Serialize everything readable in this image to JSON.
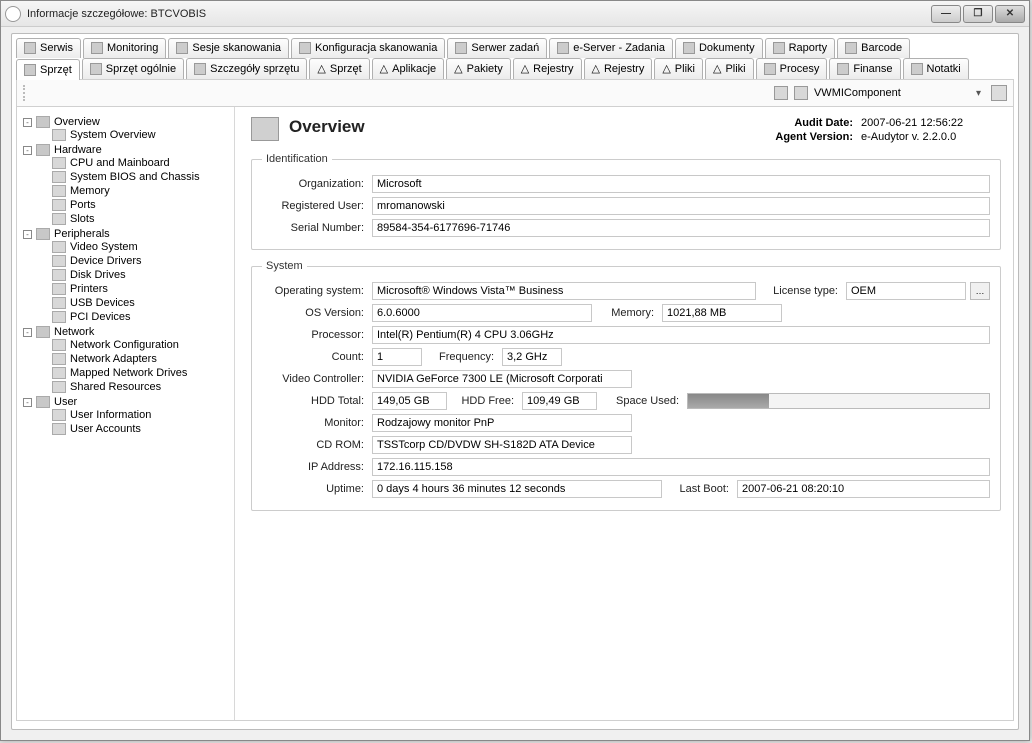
{
  "window": {
    "title": "Informacje szczegółowe: BTCVOBIS"
  },
  "winbuttons": {
    "min": "—",
    "max": "❐",
    "close": "✕"
  },
  "tabs_top": [
    {
      "label": "Serwis"
    },
    {
      "label": "Monitoring"
    },
    {
      "label": "Sesje skanowania"
    },
    {
      "label": "Konfiguracja skanowania"
    },
    {
      "label": "Serwer zadań"
    },
    {
      "label": "e-Server - Zadania"
    },
    {
      "label": "Dokumenty"
    },
    {
      "label": "Raporty"
    },
    {
      "label": "Barcode"
    }
  ],
  "tabs_bottom": [
    {
      "label": "Sprzęt",
      "active": true
    },
    {
      "label": "Sprzęt ogólnie"
    },
    {
      "label": "Szczegóły sprzętu"
    },
    {
      "label": "Sprzęt",
      "tri": true
    },
    {
      "label": "Aplikacje",
      "tri": true
    },
    {
      "label": "Pakiety",
      "tri": true
    },
    {
      "label": "Rejestry",
      "tri": true
    },
    {
      "label": "Rejestry",
      "tri": true
    },
    {
      "label": "Pliki",
      "tri": true
    },
    {
      "label": "Pliki",
      "tri": true
    },
    {
      "label": "Procesy"
    },
    {
      "label": "Finanse"
    },
    {
      "label": "Notatki"
    }
  ],
  "toolbar": {
    "component": "VWMIComponent"
  },
  "tree": {
    "overview": "Overview",
    "system_overview": "System Overview",
    "hardware": "Hardware",
    "cpu": "CPU and Mainboard",
    "bios": "System BIOS and Chassis",
    "memory": "Memory",
    "ports": "Ports",
    "slots": "Slots",
    "peripherals": "Peripherals",
    "video": "Video System",
    "drivers": "Device Drivers",
    "disks": "Disk Drives",
    "printers": "Printers",
    "usb": "USB Devices",
    "pci": "PCI Devices",
    "network": "Network",
    "netconf": "Network Configuration",
    "netadapt": "Network Adapters",
    "mapped": "Mapped Network Drives",
    "shared": "Shared Resources",
    "user": "User",
    "userinfo": "User Information",
    "useracc": "User Accounts"
  },
  "main": {
    "heading": "Overview",
    "audit_label": "Audit Date:",
    "audit_value": "2007-06-21 12:56:22",
    "agent_label": "Agent Version:",
    "agent_value": "e-Audytor  v. 2.2.0.0",
    "ident": {
      "legend": "Identification",
      "org_l": "Organization:",
      "org_v": "Microsoft",
      "user_l": "Registered User:",
      "user_v": "mromanowski",
      "serial_l": "Serial Number:",
      "serial_v": "89584-354-6177696-71746"
    },
    "sys": {
      "legend": "System",
      "os_l": "Operating system:",
      "os_v": "Microsoft® Windows Vista™ Business",
      "lic_l": "License type:",
      "lic_v": "OEM",
      "osver_l": "OS Version:",
      "osver_v": "6.0.6000",
      "mem_l": "Memory:",
      "mem_v": "1021,88 MB",
      "proc_l": "Processor:",
      "proc_v": "Intel(R) Pentium(R) 4 CPU 3.06GHz",
      "count_l": "Count:",
      "count_v": "1",
      "freq_l": "Frequency:",
      "freq_v": "3,2 GHz",
      "vid_l": "Video Controller:",
      "vid_v": "NVIDIA GeForce 7300 LE (Microsoft Corporati",
      "hddt_l": "HDD Total:",
      "hddt_v": "149,05 GB",
      "hddf_l": "HDD Free:",
      "hddf_v": "109,49 GB",
      "space_l": "Space Used:",
      "mon_l": "Monitor:",
      "mon_v": "Rodzajowy monitor PnP",
      "cd_l": "CD ROM:",
      "cd_v": "TSSTcorp CD/DVDW SH-S182D ATA Device",
      "ip_l": "IP Address:",
      "ip_v": "172.16.115.158",
      "up_l": "Uptime:",
      "up_v": "0 days 4 hours 36 minutes 12 seconds",
      "boot_l": "Last Boot:",
      "boot_v": "2007-06-21 08:20:10"
    }
  }
}
